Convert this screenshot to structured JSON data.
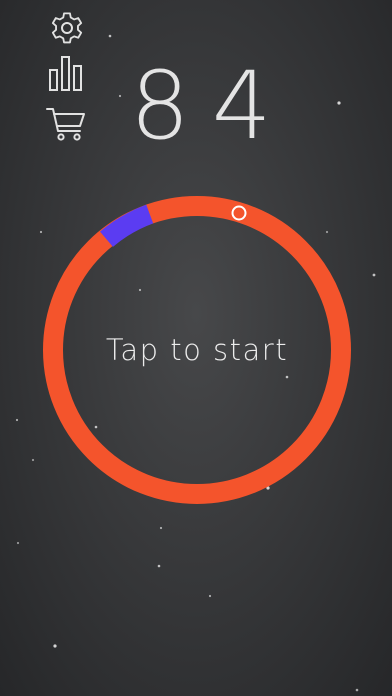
{
  "menu": {
    "settings_icon": "gear-icon",
    "stats_icon": "bar-chart-icon",
    "shop_icon": "shopping-cart-icon"
  },
  "score": "84",
  "game": {
    "prompt": "Tap to start",
    "ring_color": "#f4542c",
    "target_color": "#5b3cf2",
    "marker_color": "#ffffff"
  }
}
